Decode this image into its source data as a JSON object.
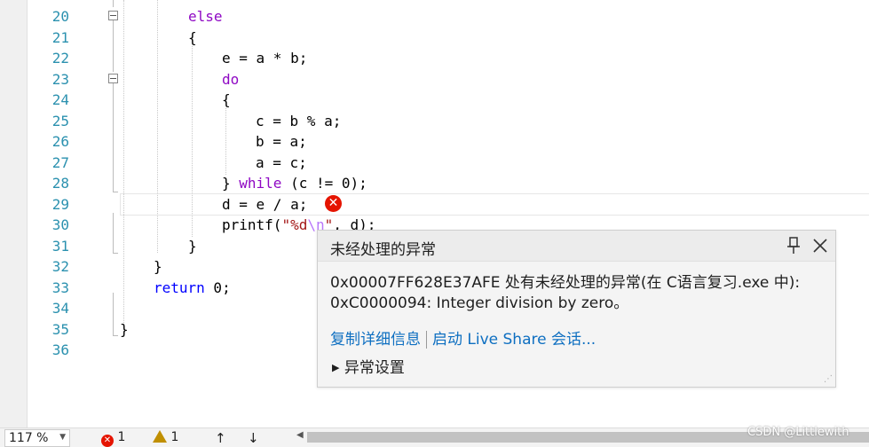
{
  "editor": {
    "lines": [
      {
        "num": "20"
      },
      {
        "num": "21"
      },
      {
        "num": "22"
      },
      {
        "num": "23"
      },
      {
        "num": "24"
      },
      {
        "num": "25"
      },
      {
        "num": "26"
      },
      {
        "num": "27"
      },
      {
        "num": "28"
      },
      {
        "num": "29"
      },
      {
        "num": "30"
      },
      {
        "num": "31"
      },
      {
        "num": "32"
      },
      {
        "num": "33"
      },
      {
        "num": "34"
      },
      {
        "num": "35"
      },
      {
        "num": "36"
      }
    ],
    "code": {
      "l20_else": "else",
      "l21": "{",
      "l22": "e = a * b;",
      "l23_do": "do",
      "l24": "{",
      "l25": "c = b % a;",
      "l26": "b = a;",
      "l27": "a = c;",
      "l28_a": "} ",
      "l28_while": "while",
      "l28_b": " (c != 0);",
      "l29": "d = e / a;",
      "l30_a": "printf(",
      "l30_s1": "\"%d",
      "l30_esc": "\\n",
      "l30_s2": "\"",
      "l30_b": ", d);",
      "l31": "}",
      "l32": "}",
      "l33_return": "return",
      "l33_b": " 0;",
      "l35": "}"
    }
  },
  "exception_popup": {
    "title": "未经处理的异常",
    "message_line1": "0x00007FF628E37AFE 处有未经处理的异常(在 C语言复习.exe 中):",
    "message_line2": "0xC0000094: Integer division by zero。",
    "copy_details_link": "复制详细信息",
    "live_share_link": "启动 Live Share 会话...",
    "settings_label": "异常设置",
    "pin_icon": "pin-icon",
    "close_icon": "close-icon"
  },
  "statusbar": {
    "zoom": "117 %",
    "error_count": "1",
    "warning_count": "1"
  },
  "watermark": "CSDN @Littlewith",
  "colors": {
    "line_number": "#2b91af",
    "keyword": "#8f08c4",
    "keyword_blue": "#0000ff",
    "string": "#a31515",
    "link": "#0e6fc1",
    "error": "#e51400"
  }
}
